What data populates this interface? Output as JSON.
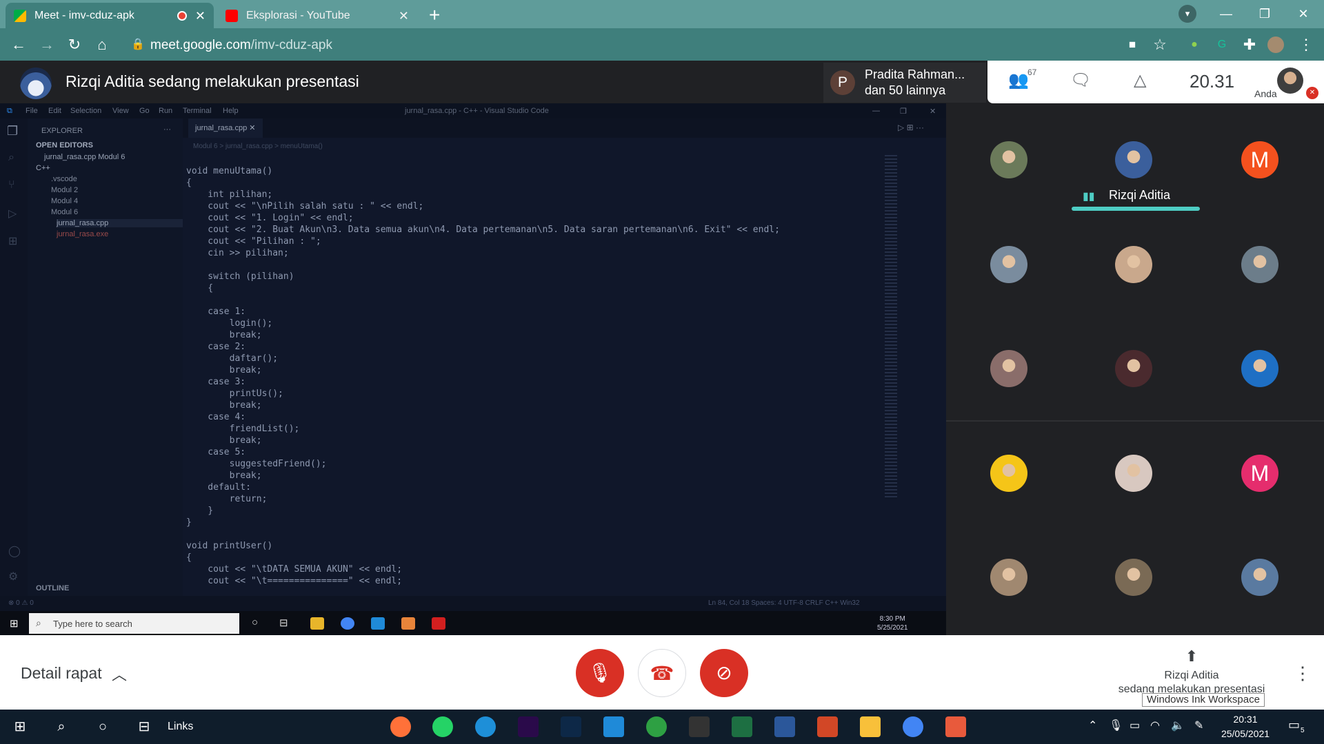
{
  "browser": {
    "tabs": [
      {
        "title": "Meet - imv-cduz-apk",
        "close": "✕"
      },
      {
        "title": "Eksplorasi - YouTube",
        "close": "✕"
      }
    ],
    "new_tab": "+",
    "url_host": "meet.google.com",
    "url_path": "/imv-cduz-apk",
    "window_buttons": [
      "—",
      "❐",
      "✕"
    ]
  },
  "meet": {
    "presenter_banner": "Rizqi Aditia sedang melakukan presentasi",
    "pinned": {
      "initial": "P",
      "name": "Pradita Rahman...",
      "sub": "dan 50 lainnya"
    },
    "people_count": "67",
    "time": "20.31",
    "self_label": "Anda",
    "active_speaker": "Rizqi Aditia",
    "tiles": [
      {
        "kind": "photo",
        "color": "#6b7a5a"
      },
      {
        "kind": "photo",
        "color": "#3b5f9c"
      },
      {
        "kind": "letter",
        "letter": "M",
        "color": "#f4511e"
      },
      {
        "kind": "photo",
        "color": "#7a8c9e"
      },
      {
        "kind": "photo",
        "color": "#c9a88c"
      },
      {
        "kind": "photo",
        "color": "#6c7d8a"
      },
      {
        "kind": "photo",
        "color": "#8a6d6a"
      },
      {
        "kind": "photo",
        "color": "#4a2a2e"
      },
      {
        "kind": "photo",
        "color": "#1e6fc4"
      },
      {
        "kind": "photo",
        "color": "#f5c518"
      },
      {
        "kind": "photo",
        "color": "#d8c8c0"
      },
      {
        "kind": "letter",
        "letter": "M",
        "color": "#e52d6d"
      },
      {
        "kind": "photo",
        "color": "#a08870"
      },
      {
        "kind": "photo",
        "color": "#7a6a55"
      },
      {
        "kind": "photo",
        "color": "#5a7aa0"
      }
    ],
    "detail_label": "Detail rapat",
    "present_name": "Rizqi Aditia",
    "present_note": "sedang melakukan presentasi",
    "ink_tooltip": "Windows Ink Workspace",
    "colors": {
      "end_call": "#d93025",
      "teal": "#4ecdc4"
    }
  },
  "vscode": {
    "menu": [
      "File",
      "Edit",
      "Selection",
      "View",
      "Go",
      "Run",
      "Terminal",
      "Help"
    ],
    "title": "jurnal_rasa.cpp - C++ - Visual Studio Code",
    "explorer_header": "EXPLORER",
    "open_editors": "OPEN EDITORS",
    "open_file": "jurnal_rasa.cpp  Modul 6",
    "tree": [
      "C++",
      ".vscode",
      "Modul 2",
      "Modul 4",
      "Modul 6",
      "jurnal_rasa.cpp",
      "jurnal_rasa.exe"
    ],
    "outline": "OUTLINE",
    "tab": "jurnal_rasa.cpp",
    "breadcrumb": "Modul 6 > jurnal_rasa.cpp > menuUtama()",
    "code": "void menuUtama()\n{\n    int pilihan;\n    cout << \"\\nPilih salah satu : \" << endl;\n    cout << \"1. Login\" << endl;\n    cout << \"2. Buat Akun\\n3. Data semua akun\\n4. Data pertemanan\\n5. Data saran pertemanan\\n6. Exit\" << endl;\n    cout << \"Pilihan : \";\n    cin >> pilihan;\n\n    switch (pilihan)\n    {\n\n    case 1:\n        login();\n        break;\n    case 2:\n        daftar();\n        break;\n    case 3:\n        printUs();\n        break;\n    case 4:\n        friendList();\n        break;\n    case 5:\n        suggestedFriend();\n        break;\n    default:\n        return;\n    }\n}\n\nvoid printUser()\n{\n    cout << \"\\tDATA SEMUA AKUN\" << endl;\n    cout << \"\\t===============\" << endl;",
    "status": "Ln 84, Col 18    Spaces: 4    UTF-8    CRLF    C++    Win32",
    "inner_search": "Type here to search",
    "inner_time": "8:30 PM",
    "inner_date": "5/25/2021"
  },
  "taskbar": {
    "links": "Links",
    "time": "20:31",
    "date": "25/05/2021",
    "notifications": "5",
    "apps": [
      {
        "name": "firefox",
        "color": "#ff7139"
      },
      {
        "name": "whatsapp",
        "color": "#25d366"
      },
      {
        "name": "edge",
        "color": "#1e8fd8"
      },
      {
        "name": "premiere",
        "color": "#2a0a4a"
      },
      {
        "name": "photoshop",
        "color": "#0d2847"
      },
      {
        "name": "vscode",
        "color": "#1f8ad8"
      },
      {
        "name": "app-green",
        "color": "#2ea043"
      },
      {
        "name": "app-dark",
        "color": "#333"
      },
      {
        "name": "excel",
        "color": "#1d6f42"
      },
      {
        "name": "word",
        "color": "#2b579a"
      },
      {
        "name": "powerpoint",
        "color": "#d24726"
      },
      {
        "name": "file-explorer",
        "color": "#f8c03a"
      },
      {
        "name": "chrome",
        "color": "#4285f4"
      },
      {
        "name": "snip",
        "color": "#e85a3c"
      }
    ]
  }
}
